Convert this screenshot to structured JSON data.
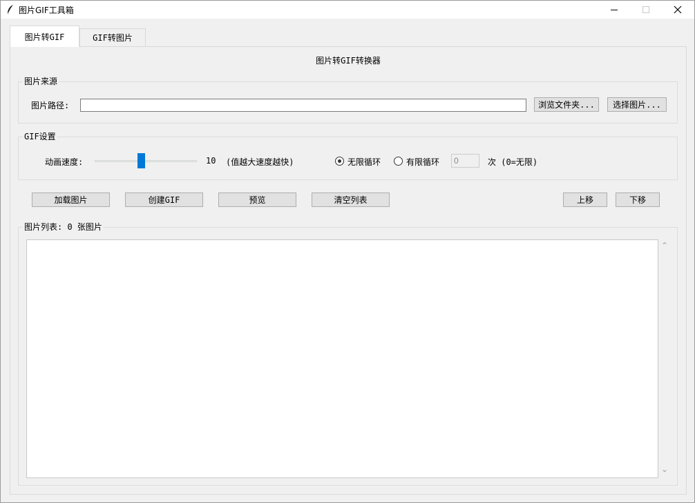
{
  "window": {
    "title": "图片GIF工具箱"
  },
  "tabs": [
    {
      "label": "图片转GIF",
      "active": true
    },
    {
      "label": "GIF转图片",
      "active": false
    }
  ],
  "main": {
    "heading": "图片转GIF转换器",
    "source": {
      "group_label": "图片来源",
      "path_label": "图片路径:",
      "path_value": "",
      "browse_folder_label": "浏览文件夹...",
      "select_images_label": "选择图片..."
    },
    "gif_settings": {
      "group_label": "GIF设置",
      "speed_label": "动画速度:",
      "speed_value": "10",
      "speed_fraction": 0.45,
      "speed_hint": "(值越大速度越快)",
      "loop_infinite_label": "无限循环",
      "loop_finite_label": "有限循环",
      "loop_selected": "infinite",
      "loop_count_value": "0",
      "loop_count_suffix": "次 (0=无限)"
    },
    "actions": {
      "load_label": "加载图片",
      "create_label": "创建GIF",
      "preview_label": "预览",
      "clear_label": "清空列表",
      "move_up_label": "上移",
      "move_down_label": "下移"
    },
    "image_list": {
      "group_label": "图片列表: 0 张图片",
      "items": []
    }
  },
  "colors": {
    "accent": "#0078d7",
    "background": "#f0f0f0",
    "button": "#e1e1e1"
  }
}
